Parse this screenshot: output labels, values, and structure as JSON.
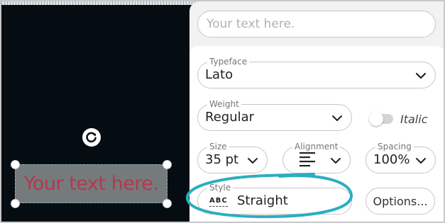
{
  "canvas": {
    "text": "Your text here.",
    "rotate_icon": "rotate-icon"
  },
  "panel": {
    "text_input": {
      "placeholder": "Your text here.",
      "value": ""
    },
    "typeface": {
      "label": "Typeface",
      "value": "Lato"
    },
    "weight": {
      "label": "Weight",
      "value": "Regular"
    },
    "italic": {
      "label": "Italic",
      "enabled": false
    },
    "size": {
      "label": "Size",
      "value": "35 pt"
    },
    "alignment": {
      "label": "Alignment",
      "icon": "align-left-icon"
    },
    "spacing": {
      "label": "Spacing",
      "value": "100%"
    },
    "style": {
      "label": "Style",
      "value": "Straight",
      "icon_text": "ABC"
    },
    "options_label": "Options..."
  },
  "colors": {
    "canvas_bg": "#060d12",
    "text_color": "#b3394f",
    "annotation": "#2aaec0"
  }
}
